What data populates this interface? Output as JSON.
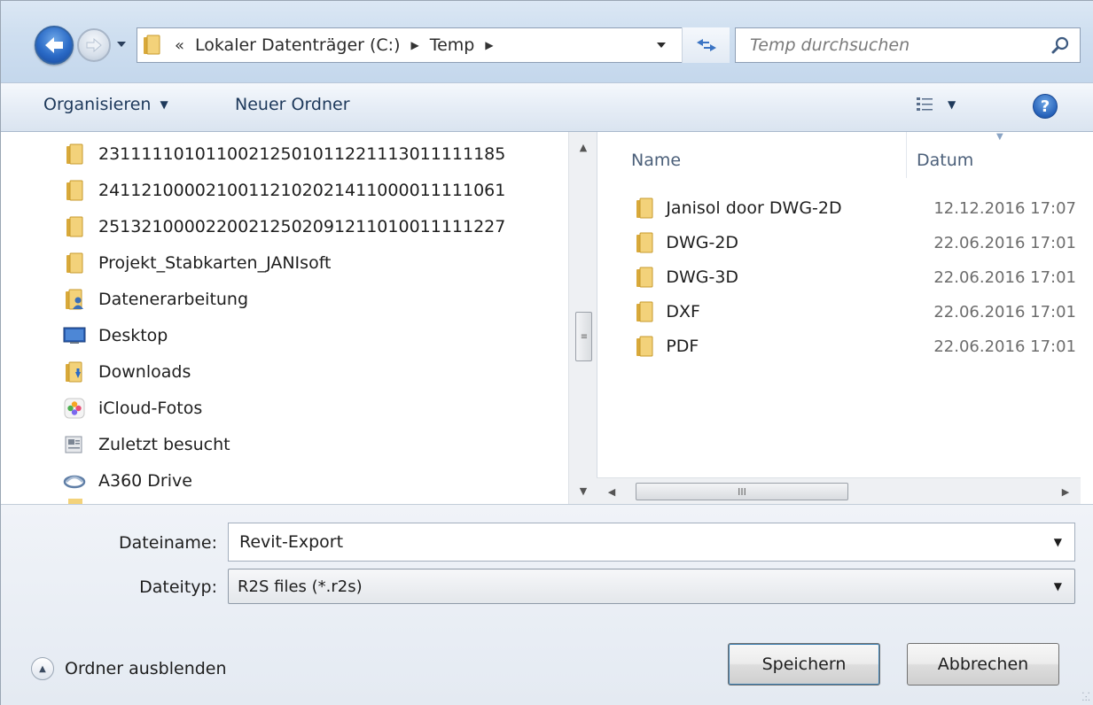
{
  "address": {
    "overflow": "«",
    "crumbs": [
      "Lokaler Datenträger (C:)",
      "Temp"
    ]
  },
  "search": {
    "placeholder": "Temp durchsuchen"
  },
  "toolbar": {
    "organize_label": "Organisieren",
    "new_folder_label": "Neuer Ordner",
    "help_label": "?"
  },
  "nav_tree": {
    "items": [
      {
        "label": "23111110101100212501011221113011111185",
        "icon": "folder-icon"
      },
      {
        "label": "24112100002100112102021411000011111061",
        "icon": "folder-icon"
      },
      {
        "label": "25132100002200212502091211010011111227",
        "icon": "folder-icon"
      },
      {
        "label": "Projekt_Stabkarten_JANIsoft",
        "icon": "folder-icon"
      },
      {
        "label": "Datenerarbeitung",
        "icon": "user-folder-icon"
      },
      {
        "label": "Desktop",
        "icon": "desktop-icon"
      },
      {
        "label": "Downloads",
        "icon": "downloads-folder-icon"
      },
      {
        "label": "iCloud-Fotos",
        "icon": "icloud-photos-icon"
      },
      {
        "label": "Zuletzt besucht",
        "icon": "recent-places-icon"
      },
      {
        "label": "A360 Drive",
        "icon": "a360-drive-icon"
      }
    ]
  },
  "file_list": {
    "columns": {
      "name": "Name",
      "date": "Datum"
    },
    "rows": [
      {
        "name": "Janisol door DWG-2D",
        "date": "12.12.2016 17:07"
      },
      {
        "name": "DWG-2D",
        "date": "22.06.2016 17:01"
      },
      {
        "name": "DWG-3D",
        "date": "22.06.2016 17:01"
      },
      {
        "name": "DXF",
        "date": "22.06.2016 17:01"
      },
      {
        "name": "PDF",
        "date": "22.06.2016 17:01"
      }
    ]
  },
  "save_form": {
    "filename_label": "Dateiname:",
    "filename_value": "Revit-Export",
    "filetype_label": "Dateityp:",
    "filetype_value": "R2S files (*.r2s)"
  },
  "footer": {
    "hide_folders_label": "Ordner ausblenden",
    "save_label": "Speichern",
    "cancel_label": "Abbrechen"
  },
  "colors": {
    "folder": "#e8c15a",
    "accent": "#2a6ac6",
    "chrome": "#dbe7f4"
  }
}
